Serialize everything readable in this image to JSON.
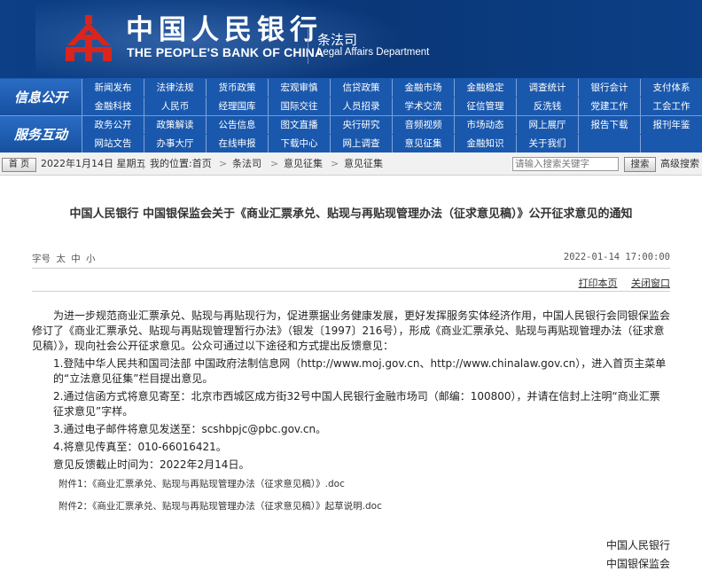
{
  "colors": {
    "banner": "#0c3f86",
    "nav": "#1a58ad",
    "nav_divider": "#7da3dc"
  },
  "header": {
    "logo_icon": "pboc-emblem-icon",
    "bank_name_cn": "中国人民银行",
    "bank_name_en": "THE PEOPLE'S BANK OF CHINA",
    "dept_cn": "条法司",
    "dept_en": "Legal Affairs Department"
  },
  "nav": {
    "section1_label": "信息公开",
    "section2_label": "服务互动",
    "row1": [
      "新闻发布",
      "法律法规",
      "货币政策",
      "宏观审慎",
      "信贷政策",
      "金融市场",
      "金融稳定",
      "调查统计",
      "银行会计",
      "支付体系"
    ],
    "row2": [
      "金融科技",
      "人民币",
      "经理国库",
      "国际交往",
      "人员招录",
      "学术交流",
      "征信管理",
      "反洗钱",
      "党建工作",
      "工会工作"
    ],
    "row3": [
      "政务公开",
      "政策解读",
      "公告信息",
      "图文直播",
      "央行研究",
      "音频视频",
      "市场动态",
      "网上展厅",
      "报告下载",
      "报刊年鉴"
    ],
    "row4": [
      "网站文告",
      "办事大厅",
      "在线申报",
      "下载中心",
      "网上调查",
      "意见征集",
      "金融知识",
      "关于我们"
    ]
  },
  "breadcrumb": {
    "home_button": "首 页",
    "date": "2022年1月14日 星期五",
    "location_label": "我的位置:首页",
    "crumb1": "条法司",
    "crumb2": "意见征集",
    "crumb3": "意见征集",
    "separator": ">",
    "search_placeholder": "请输入搜索关键字",
    "search_button": "搜索",
    "advanced_search": "高级搜索"
  },
  "article": {
    "title": "中国人民银行 中国银保监会关于《商业汇票承兑、贴现与再贴现管理办法（征求意见稿）》公开征求意见的通知",
    "font_size_label": "字号",
    "font_large": "太",
    "font_medium": "中",
    "font_small": "小",
    "publish_time": "2022-01-14 17:00:00",
    "print_link": "打印本页",
    "close_link": "关闭窗口",
    "intro": "为进一步规范商业汇票承兑、贴现与再贴现行为，促进票据业务健康发展，更好发挥服务实体经济作用，中国人民银行会同银保监会修订了《商业汇票承兑、贴现与再贴现管理暂行办法》（银发〔1997〕216号），形成《商业汇票承兑、贴现与再贴现管理办法（征求意见稿）》，现向社会公开征求意见。公众可通过以下途径和方式提出反馈意见：",
    "item1": "1.登陆中华人民共和国司法部 中国政府法制信息网（http://www.moj.gov.cn、http://www.chinalaw.gov.cn），进入首页主菜单的“立法意见征集”栏目提出意见。",
    "item2": "2.通过信函方式将意见寄至：北京市西城区成方街32号中国人民银行金融市场司（邮编：100800），并请在信封上注明“商业汇票征求意见”字样。",
    "item3": "3.通过电子邮件将意见发送至：scshbpjc@pbc.gov.cn。",
    "item4": "4.将意见传真至：010-66016421。",
    "deadline": "意见反馈截止时间为：2022年2月14日。",
    "attachment1": "附件1：《商业汇票承兑、贴现与再贴现管理办法（征求意见稿）》.doc",
    "attachment2": "附件2：《商业汇票承兑、贴现与再贴现管理办法（征求意见稿）》起草说明.doc",
    "signer1": "中国人民银行",
    "signer2": "中国银保监会"
  }
}
